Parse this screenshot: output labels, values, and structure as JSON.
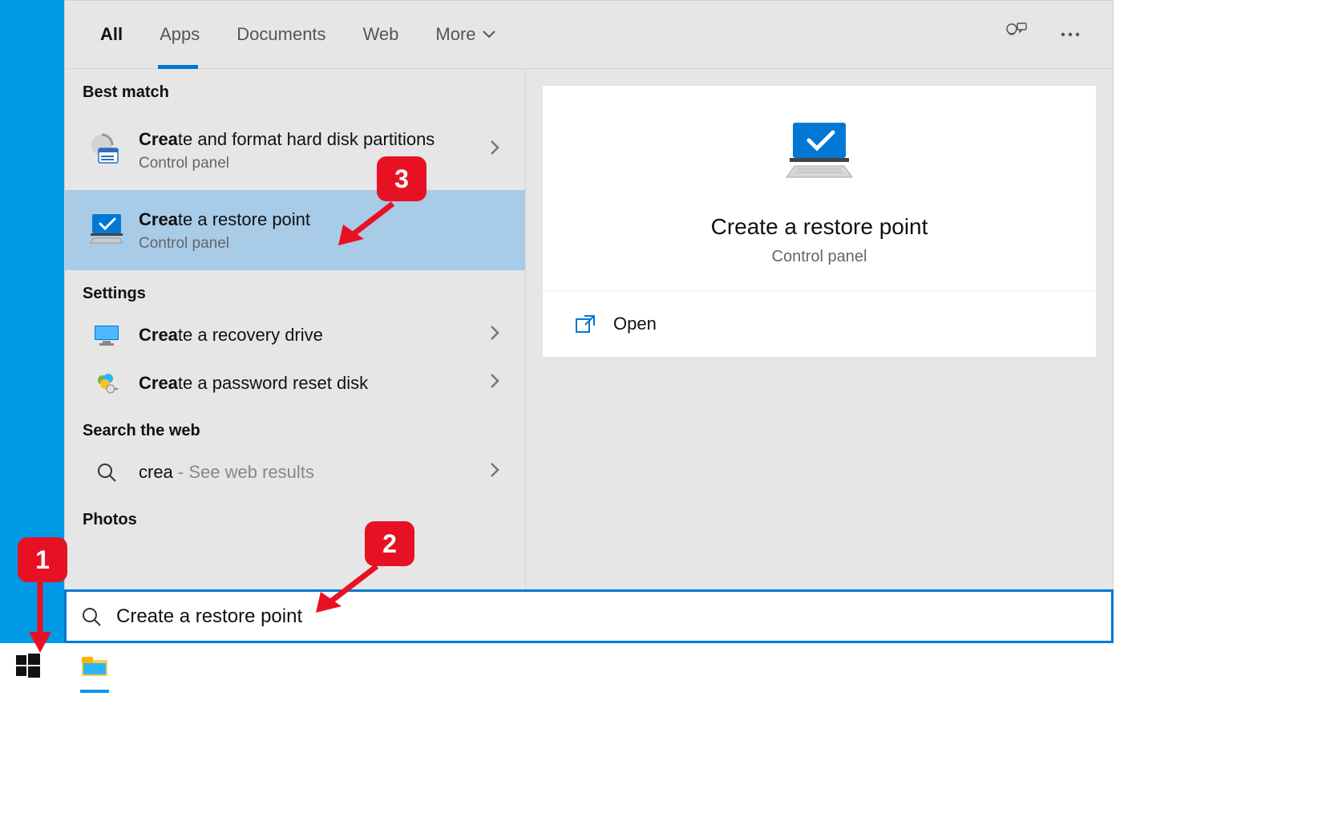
{
  "tabs": [
    "All",
    "Apps",
    "Documents",
    "Web",
    "More"
  ],
  "active_tab": 0,
  "sections": {
    "best_match": "Best match",
    "settings": "Settings",
    "search_web": "Search the web",
    "photos": "Photos"
  },
  "results": {
    "r1": {
      "title_bold": "Crea",
      "title_rest": "te and format hard disk partitions",
      "sub": "Control panel"
    },
    "r2": {
      "title_bold": "Crea",
      "title_rest": "te a restore point",
      "sub": "Control panel"
    },
    "r3": {
      "title_bold": "Crea",
      "title_rest": "te a recovery drive"
    },
    "r4": {
      "title_bold": "Crea",
      "title_rest": "te a password reset disk"
    },
    "r5": {
      "prefix": "crea",
      "suffix": " - See web results"
    }
  },
  "preview": {
    "title": "Create a restore point",
    "sub": "Control panel",
    "action_open": "Open"
  },
  "search_value": "Create a restore point",
  "markers": {
    "m1": "1",
    "m2": "2",
    "m3": "3"
  }
}
